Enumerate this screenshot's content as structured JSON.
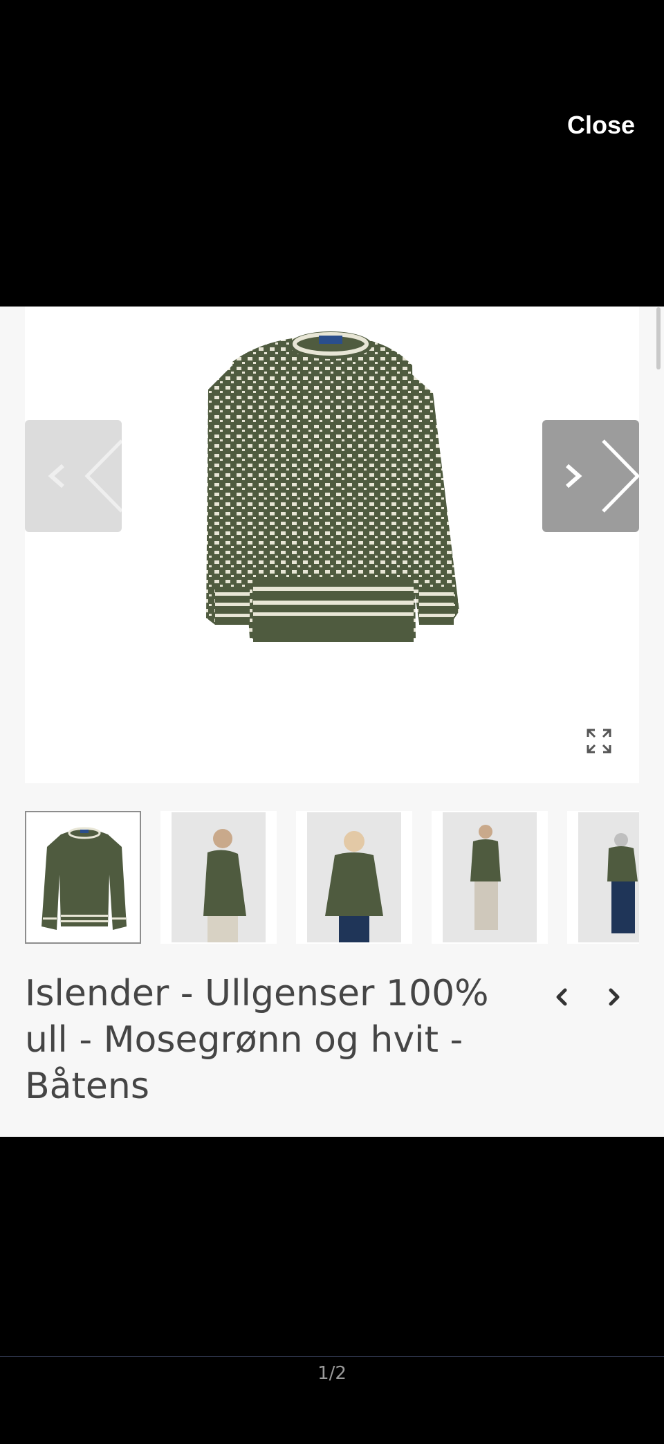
{
  "header": {
    "close_label": "Close"
  },
  "gallery": {
    "main_image_alt": "sweater-front",
    "thumbnails": [
      {
        "name": "thumb-sweater-front",
        "active": true
      },
      {
        "name": "thumb-man-side",
        "active": false
      },
      {
        "name": "thumb-woman-front",
        "active": false
      },
      {
        "name": "thumb-man-full",
        "active": false
      },
      {
        "name": "thumb-man-back",
        "active": false
      }
    ]
  },
  "product": {
    "title": "Islender - Ullgenser 100% ull - Mosegrønn og hvit - Båtens"
  },
  "footer": {
    "page_indicator": "1/2"
  },
  "colors": {
    "sweater_green": "#4f5b3f",
    "sweater_cream": "#e8e6d6"
  }
}
